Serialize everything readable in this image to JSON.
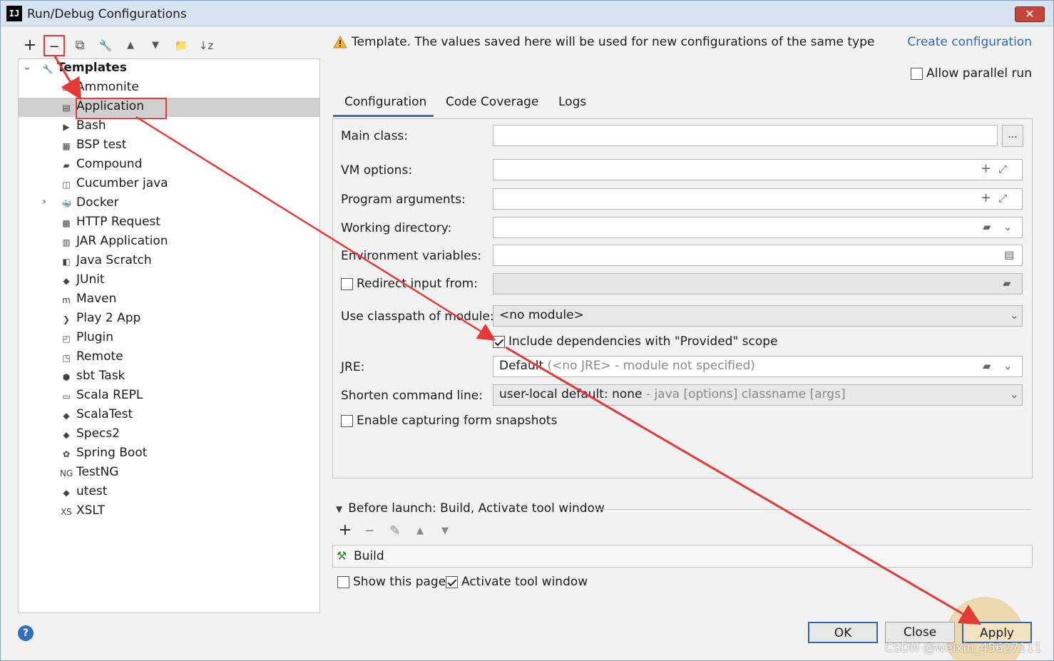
{
  "window": {
    "title": "Run/Debug Configurations",
    "logo_text": "IJ",
    "close_symbol": "✕"
  },
  "left_toolbar": {
    "add": "+",
    "remove": "−",
    "copy": "⧉",
    "settings": "🔧",
    "move_up": "▲",
    "move_down": "▼",
    "folder": "📁",
    "sort": "↓z"
  },
  "tree": {
    "root_label": "Templates",
    "items": [
      {
        "label": "Ammonite",
        "icon": "ammonite-icon",
        "glyph": "▭"
      },
      {
        "label": "Application",
        "icon": "application-icon",
        "glyph": "▤",
        "selected": true
      },
      {
        "label": "Bash",
        "icon": "bash-icon",
        "glyph": "▶"
      },
      {
        "label": "BSP test",
        "icon": "bsp-icon",
        "glyph": "▦"
      },
      {
        "label": "Compound",
        "icon": "compound-icon",
        "glyph": "▰"
      },
      {
        "label": "Cucumber java",
        "icon": "cucumber-icon",
        "glyph": "◫"
      },
      {
        "label": "Docker",
        "icon": "docker-icon",
        "glyph": "🐳",
        "expandable": true
      },
      {
        "label": "HTTP Request",
        "icon": "http-request-icon",
        "glyph": "▩"
      },
      {
        "label": "JAR Application",
        "icon": "jar-icon",
        "glyph": "▥"
      },
      {
        "label": "Java Scratch",
        "icon": "java-scratch-icon",
        "glyph": "◧"
      },
      {
        "label": "JUnit",
        "icon": "junit-icon",
        "glyph": "◆"
      },
      {
        "label": "Maven",
        "icon": "maven-icon",
        "glyph": "m"
      },
      {
        "label": "Play 2 App",
        "icon": "play-icon",
        "glyph": "❯"
      },
      {
        "label": "Plugin",
        "icon": "plugin-icon",
        "glyph": "◰"
      },
      {
        "label": "Remote",
        "icon": "remote-icon",
        "glyph": "◳"
      },
      {
        "label": "sbt Task",
        "icon": "sbt-icon",
        "glyph": "⬢"
      },
      {
        "label": "Scala REPL",
        "icon": "scala-repl-icon",
        "glyph": "▭"
      },
      {
        "label": "ScalaTest",
        "icon": "scalatest-icon",
        "glyph": "◆"
      },
      {
        "label": "Specs2",
        "icon": "specs2-icon",
        "glyph": "◆"
      },
      {
        "label": "Spring Boot",
        "icon": "spring-boot-icon",
        "glyph": "✿"
      },
      {
        "label": "TestNG",
        "icon": "testng-icon",
        "glyph": "NG"
      },
      {
        "label": "utest",
        "icon": "utest-icon",
        "glyph": "◆"
      },
      {
        "label": "XSLT",
        "icon": "xslt-icon",
        "glyph": "XS"
      }
    ]
  },
  "header": {
    "warning_text": "Template. The values saved here will be used for new configurations of the same type",
    "create_link": "Create configuration",
    "allow_parallel": "Allow parallel run"
  },
  "tabs": [
    {
      "label": "Configuration",
      "active": true
    },
    {
      "label": "Code Coverage"
    },
    {
      "label": "Logs"
    }
  ],
  "form": {
    "main_class_label": "Main class:",
    "main_class_value": "",
    "main_class_button": "...",
    "vm_options_label": "VM options:",
    "vm_options_value": "",
    "program_args_label": "Program arguments:",
    "program_args_value": "",
    "working_dir_label": "Working directory:",
    "working_dir_value": "",
    "env_vars_label": "Environment variables:",
    "env_vars_value": "",
    "redirect_input_label": "Redirect input from:",
    "redirect_input_checked": false,
    "classpath_label": "Use classpath of module:",
    "classpath_value": "<no module>",
    "include_deps_label": "Include dependencies with \"Provided\" scope",
    "include_deps_checked": true,
    "jre_label": "JRE:",
    "jre_value": "Default",
    "jre_hint": "(<no JRE> - module not specified)",
    "shorten_label": "Shorten command line:",
    "shorten_value": "user-local default: none",
    "shorten_hint": "- java [options] classname [args]",
    "snapshots_label": "Enable capturing form snapshots",
    "snapshots_checked": false
  },
  "before_launch": {
    "header": "Before launch: Build, Activate tool window",
    "toolbar": {
      "add": "+",
      "remove": "−",
      "edit": "✎",
      "up": "▲",
      "down": "▼"
    },
    "items": [
      {
        "label": "Build",
        "icon": "hammer-icon"
      }
    ],
    "show_page_label": "Show this page",
    "show_page_checked": false,
    "activate_label": "Activate tool window",
    "activate_checked": true
  },
  "footer": {
    "help": "?",
    "ok": "OK",
    "close": "Close",
    "apply": "Apply"
  },
  "watermark": "CSDN @weixin_45627111",
  "colors": {
    "annotation_red": "#e53935",
    "link_blue": "#2a6ab2",
    "accent_blue": "#3b6fb6"
  }
}
